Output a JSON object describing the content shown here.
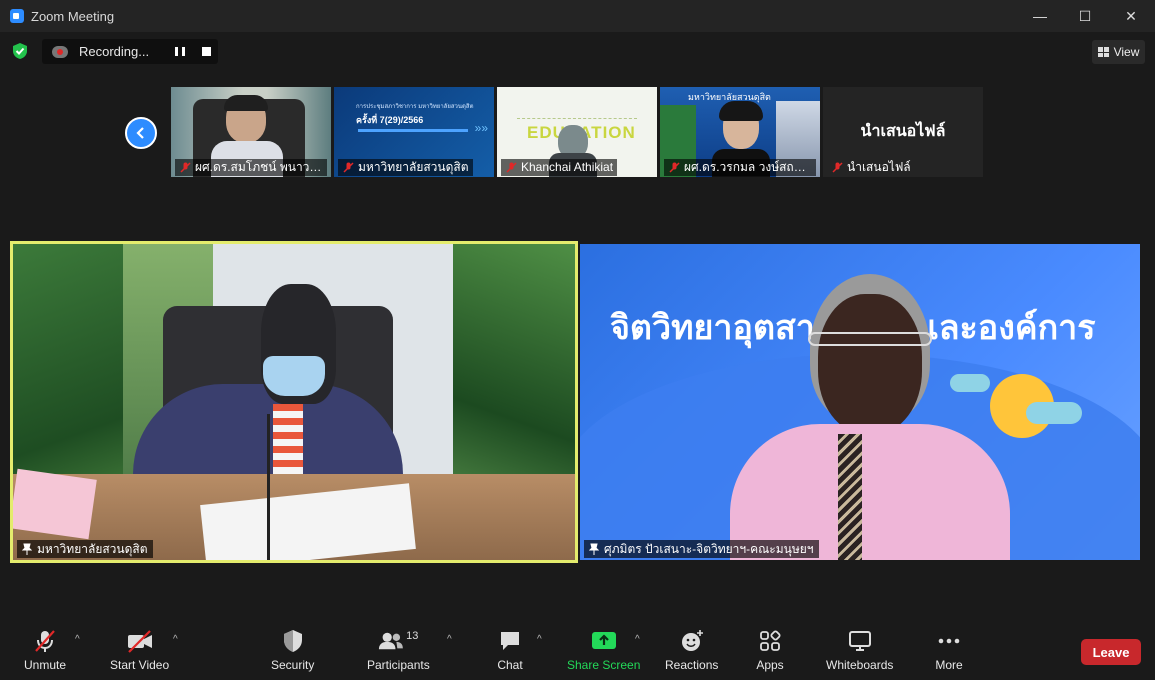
{
  "window": {
    "title": "Zoom Meeting",
    "minimize": "—",
    "maximize": "☐",
    "close": "✕"
  },
  "recording": {
    "label": "Recording..."
  },
  "view": {
    "label": "View"
  },
  "thumbnails": [
    {
      "name": "ผศ.ดร.สมโภชน์ พนาวาส"
    },
    {
      "name": "มหาวิทยาลัยสวนดุสิต",
      "slide_title": "การประชุมสภาวิชาการ มหาวิทยาลัยสวนดุสิต",
      "slide_sub": "ครั้งที่ 7(29)/2566"
    },
    {
      "name": "Khanchai Athikiat",
      "slide_word": "EDUCATION"
    },
    {
      "name": "ผศ.ดร.วรกมล วงษ์สถาปน...",
      "banner": "มหาวิทยาลัยสวนดุสิต"
    },
    {
      "name": "นำเสนอไฟล์",
      "center": "นำเสนอไฟล์"
    }
  ],
  "tiles": [
    {
      "name": "มหาวิทยาลัยสวนดุสิต",
      "active": true
    },
    {
      "name": "ศุภมิตร ปัวเสนาะ-จิตวิทยาฯ-คณะมนุษยฯ",
      "bg_text": "จิตวิทยาอุตสาหกรรมและองค์การ"
    }
  ],
  "toolbar": {
    "unmute": "Unmute",
    "start_video": "Start Video",
    "security": "Security",
    "participants": "Participants",
    "participants_count": "13",
    "chat": "Chat",
    "share_screen": "Share Screen",
    "reactions": "Reactions",
    "apps": "Apps",
    "whiteboards": "Whiteboards",
    "more": "More",
    "leave": "Leave"
  },
  "colors": {
    "accent": "#2d8cff",
    "share": "#23d959",
    "leave": "#c8282c",
    "active_border": "#e4ec6d"
  }
}
